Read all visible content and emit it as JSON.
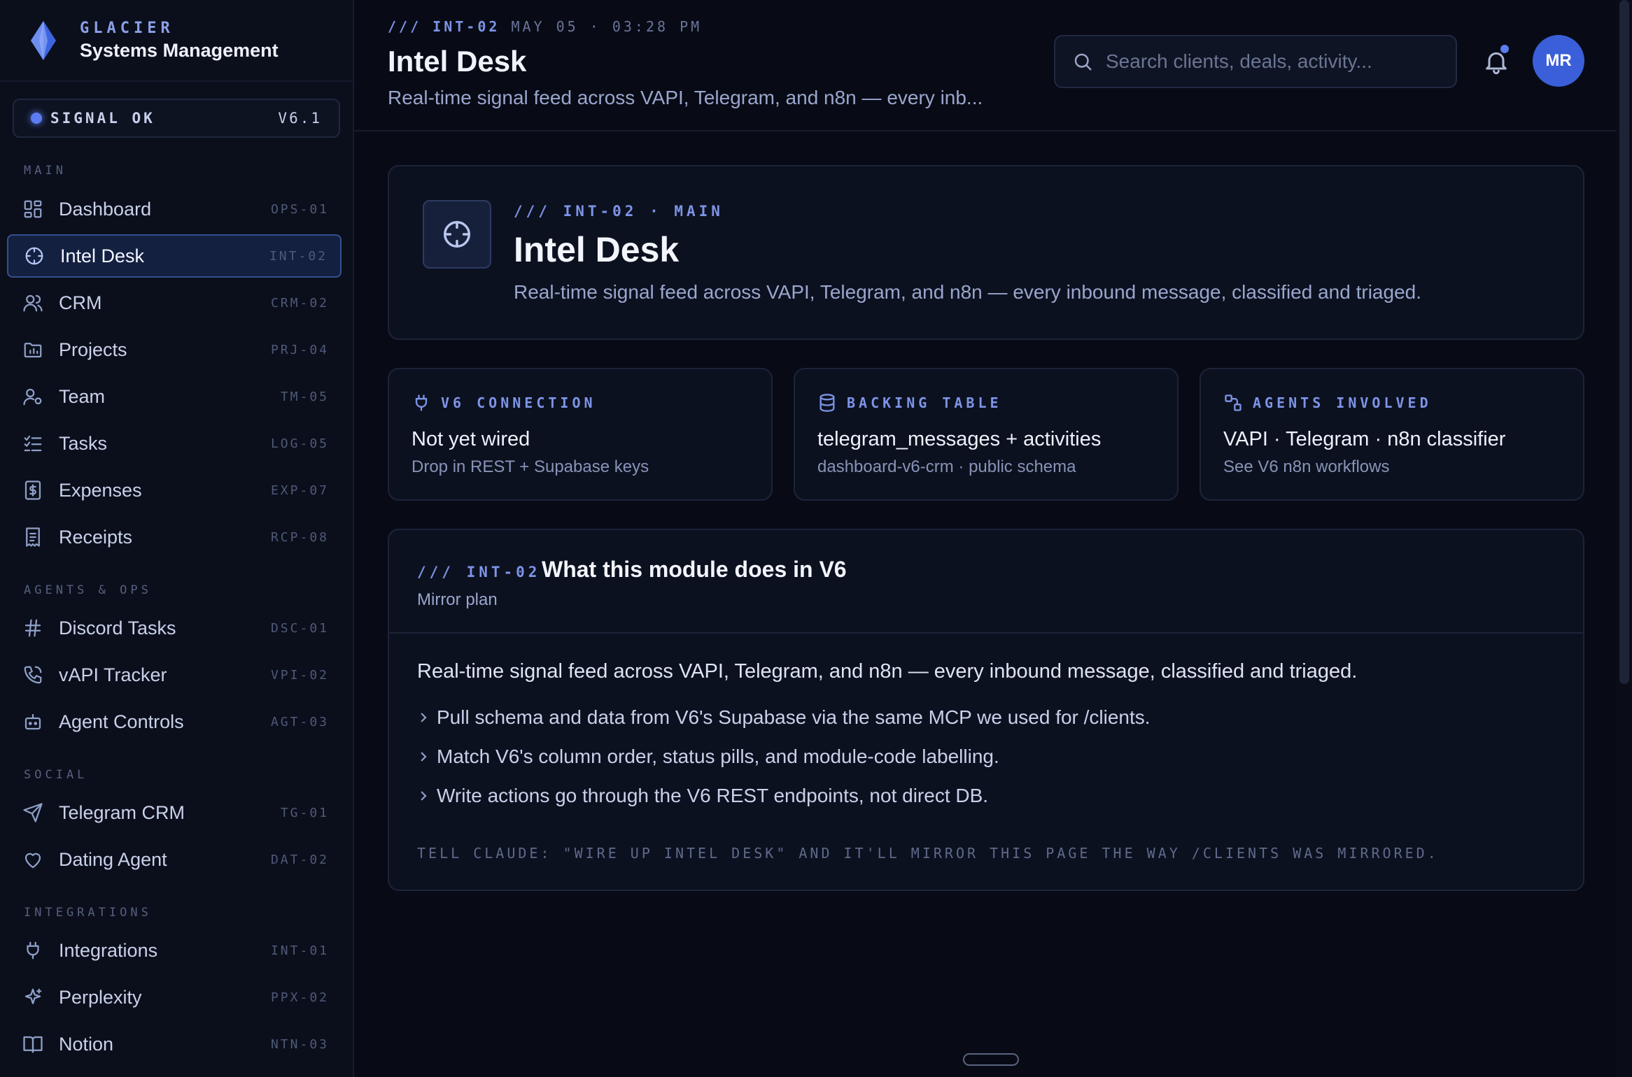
{
  "brand": {
    "kicker": "GLACIER",
    "name": "Systems Management"
  },
  "status": {
    "label": "SIGNAL OK",
    "version": "V6.1"
  },
  "nav": {
    "sections": {
      "main": "MAIN",
      "agents": "AGENTS & OPS",
      "social": "SOCIAL",
      "integrations": "INTEGRATIONS"
    },
    "items": [
      {
        "label": "Dashboard",
        "code": "OPS-01",
        "icon": "dashboard-icon"
      },
      {
        "label": "Intel Desk",
        "code": "INT-02",
        "icon": "crosshair-icon",
        "active": true
      },
      {
        "label": "CRM",
        "code": "CRM-02",
        "icon": "users-icon"
      },
      {
        "label": "Projects",
        "code": "PRJ-04",
        "icon": "folder-chart-icon"
      },
      {
        "label": "Team",
        "code": "TM-05",
        "icon": "user-gear-icon"
      },
      {
        "label": "Tasks",
        "code": "LOG-05",
        "icon": "checklist-icon"
      },
      {
        "label": "Expenses",
        "code": "EXP-07",
        "icon": "dollar-file-icon"
      },
      {
        "label": "Receipts",
        "code": "RCP-08",
        "icon": "receipt-icon"
      },
      {
        "label": "Discord Tasks",
        "code": "DSC-01",
        "icon": "hash-icon"
      },
      {
        "label": "vAPI Tracker",
        "code": "VPI-02",
        "icon": "phone-icon"
      },
      {
        "label": "Agent Controls",
        "code": "AGT-03",
        "icon": "bot-icon"
      },
      {
        "label": "Telegram CRM",
        "code": "TG-01",
        "icon": "send-icon"
      },
      {
        "label": "Dating Agent",
        "code": "DAT-02",
        "icon": "heart-icon"
      },
      {
        "label": "Integrations",
        "code": "INT-01",
        "icon": "plug-icon"
      },
      {
        "label": "Perplexity",
        "code": "PPX-02",
        "icon": "sparkle-icon"
      },
      {
        "label": "Notion",
        "code": "NTN-03",
        "icon": "book-icon"
      }
    ]
  },
  "header": {
    "code": "/// INT-02",
    "timestamp": "MAY 05 · 03:28 PM",
    "title": "Intel Desk",
    "subtitle": "Real-time signal feed across VAPI, Telegram, and n8n — every inb..."
  },
  "search": {
    "placeholder": "Search clients, deals, activity..."
  },
  "user": {
    "initials": "MR"
  },
  "hero": {
    "kicker": "/// INT-02 · MAIN",
    "title": "Intel Desk",
    "subtitle": "Real-time signal feed across VAPI, Telegram, and n8n — every inbound message, classified and triaged."
  },
  "info_cards": [
    {
      "kicker": "V6 CONNECTION",
      "value": "Not yet wired",
      "note": "Drop in REST + Supabase keys",
      "icon": "plug-icon"
    },
    {
      "kicker": "BACKING TABLE",
      "value": "telegram_messages + activities",
      "note": "dashboard-v6-crm · public schema",
      "icon": "database-icon"
    },
    {
      "kicker": "AGENTS INVOLVED",
      "value": "VAPI · Telegram · n8n classifier",
      "note": "See V6 n8n workflows",
      "icon": "workflow-icon"
    }
  ],
  "module": {
    "kicker": "/// INT-02",
    "title": "What this module does in V6",
    "subtitle": "Mirror plan",
    "lead": "Real-time signal feed across VAPI, Telegram, and n8n — every inbound message, classified and triaged.",
    "bullets": [
      "Pull schema and data from V6's Supabase via the same MCP we used for /clients.",
      "Match V6's column order, status pills, and module-code labelling.",
      "Write actions go through the V6 REST endpoints, not direct DB."
    ],
    "footer": "TELL CLAUDE: \"WIRE UP INTEL DESK\" AND IT'LL MIRROR THIS PAGE THE WAY /CLIENTS WAS MIRRORED."
  },
  "colors": {
    "background": "#080b16",
    "sidebar": "#0b0f1c",
    "accent": "#5b7df0",
    "active_nav": "#142040"
  }
}
